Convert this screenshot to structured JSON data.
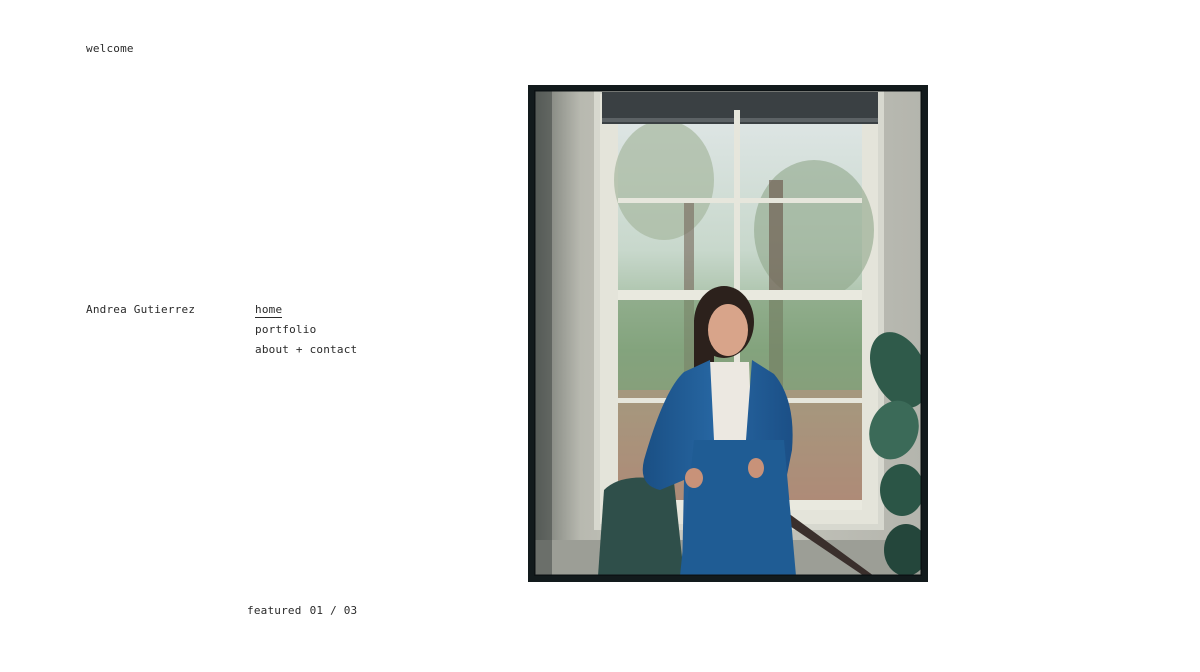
{
  "header": {
    "welcome": "welcome"
  },
  "site": {
    "owner_name": "Andrea Gutierrez"
  },
  "nav": {
    "items": [
      {
        "label": "home",
        "active": true
      },
      {
        "label": "portfolio",
        "active": false
      },
      {
        "label": "about + contact",
        "active": false
      }
    ]
  },
  "featured": {
    "label": "featured",
    "current": "01",
    "divider": "/",
    "total": "03"
  },
  "colors": {
    "background": "#ffffff",
    "text": "#2a2a2a",
    "frame": "#121a1c",
    "coat_blue": "#1f5c94"
  },
  "photo": {
    "frame_icon": "featured-photo"
  }
}
